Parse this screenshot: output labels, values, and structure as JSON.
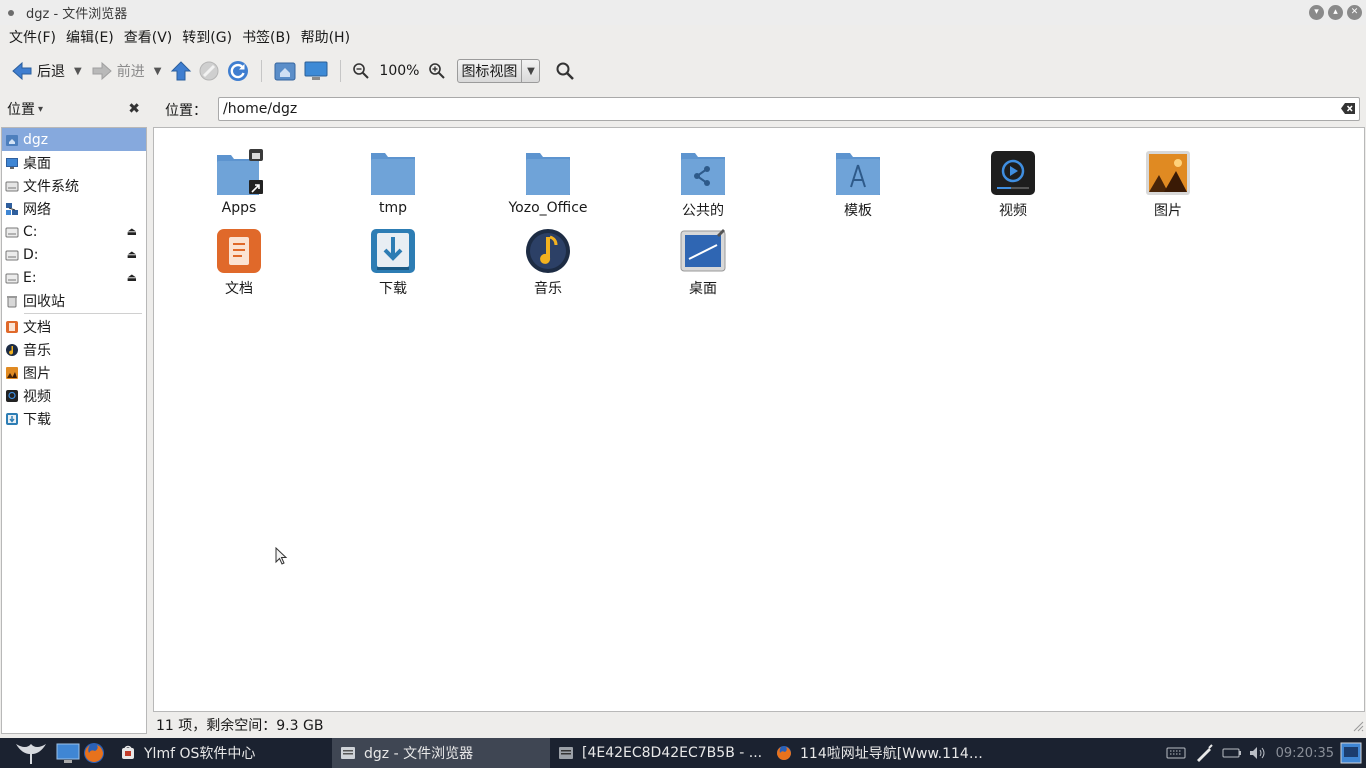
{
  "window": {
    "title": "dgz - 文件浏览器"
  },
  "menu": [
    "文件(F)",
    "编辑(E)",
    "查看(V)",
    "转到(G)",
    "书签(B)",
    "帮助(H)"
  ],
  "toolbar": {
    "back_label": "后退",
    "forward_label": "前进",
    "zoom_level": "100%",
    "view_mode": "图标视图"
  },
  "sidebar_header": {
    "label": "位置"
  },
  "location": {
    "label": "位置：",
    "path": "/home/dgz"
  },
  "sidebar": {
    "places": [
      {
        "label": "dgz",
        "icon": "home-icon",
        "selected": true
      },
      {
        "label": "桌面",
        "icon": "desktop-icon"
      },
      {
        "label": "文件系统",
        "icon": "filesystem-icon"
      },
      {
        "label": "网络",
        "icon": "network-icon"
      },
      {
        "label": "C:",
        "icon": "drive-icon",
        "eject": true
      },
      {
        "label": "D:",
        "icon": "drive-icon",
        "eject": true
      },
      {
        "label": "E:",
        "icon": "drive-icon",
        "eject": true
      },
      {
        "label": "回收站",
        "icon": "trash-icon"
      }
    ],
    "bookmarks": [
      {
        "label": "文档",
        "icon": "documents-icon"
      },
      {
        "label": "音乐",
        "icon": "music-icon"
      },
      {
        "label": "图片",
        "icon": "pictures-icon"
      },
      {
        "label": "视频",
        "icon": "videos-icon"
      },
      {
        "label": "下载",
        "icon": "downloads-icon"
      }
    ]
  },
  "files": [
    {
      "name": "Apps",
      "icon": "folder-link-locked-icon"
    },
    {
      "name": "tmp",
      "icon": "folder-icon"
    },
    {
      "name": "Yozo_Office",
      "icon": "folder-icon"
    },
    {
      "name": "公共的",
      "icon": "folder-share-icon"
    },
    {
      "name": "模板",
      "icon": "folder-templates-icon"
    },
    {
      "name": "视频",
      "icon": "videos-icon"
    },
    {
      "name": "图片",
      "icon": "pictures-icon"
    },
    {
      "name": "文档",
      "icon": "documents-icon"
    },
    {
      "name": "下载",
      "icon": "downloads-icon"
    },
    {
      "name": "音乐",
      "icon": "music-icon"
    },
    {
      "name": "桌面",
      "icon": "desktop-icon"
    }
  ],
  "status": {
    "text": "11 项，剩余空间：9.3 GB"
  },
  "taskbar": {
    "tasks": [
      {
        "label": "Ylmf OS软件中心",
        "icon": "software-center-icon",
        "active": false
      },
      {
        "label": "dgz - 文件浏览器",
        "icon": "file-manager-icon",
        "active": true
      },
      {
        "label": "[4E42EC8D42EC7B5B - ...",
        "icon": "file-manager-icon",
        "active": false
      },
      {
        "label": "114啦网址导航[Www.114…",
        "icon": "firefox-icon",
        "active": false
      }
    ],
    "clock": "09:20:35"
  },
  "colors": {
    "selection": "#86a9dd",
    "taskbar": "#1b2230",
    "folder": "#6fa3d8"
  }
}
